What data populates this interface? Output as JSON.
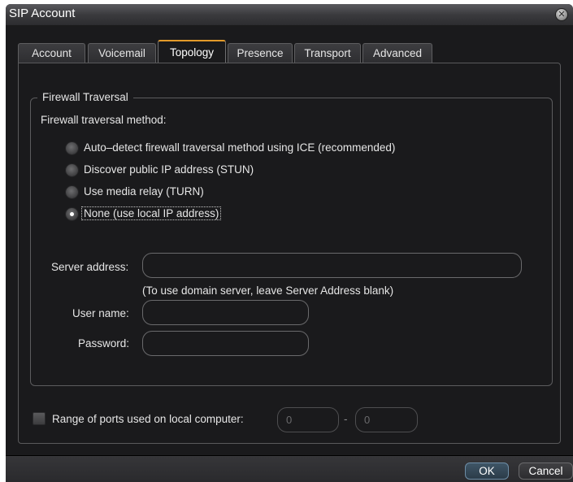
{
  "window": {
    "title": "SIP Account"
  },
  "tabs": [
    {
      "label": "Account"
    },
    {
      "label": "Voicemail"
    },
    {
      "label": "Topology",
      "active": true
    },
    {
      "label": "Presence"
    },
    {
      "label": "Transport"
    },
    {
      "label": "Advanced"
    }
  ],
  "firewall": {
    "group_title": "Firewall Traversal",
    "method_label": "Firewall traversal method:",
    "options": [
      {
        "label": "Auto–detect firewall traversal method using ICE (recommended)",
        "selected": false
      },
      {
        "label": "Discover public IP address (STUN)",
        "selected": false
      },
      {
        "label": "Use media relay (TURN)",
        "selected": false
      },
      {
        "label": "None (use local IP address)",
        "selected": true
      }
    ],
    "server_address_label": "Server address:",
    "server_address_value": "",
    "server_hint": "(To use domain server, leave Server Address blank)",
    "username_label": "User name:",
    "username_value": "",
    "password_label": "Password:",
    "password_value": ""
  },
  "ports": {
    "checkbox_label": "Range of ports used on local computer:",
    "checked": false,
    "from_value": "0",
    "separator": "-",
    "to_value": "0"
  },
  "footer": {
    "ok_label": "OK",
    "cancel_label": "Cancel"
  },
  "colors": {
    "accent_tab": "#e39a2a",
    "background": "#1a1a1c",
    "ok_border": "#6d8da6"
  },
  "icons": {
    "close": "close-icon"
  }
}
